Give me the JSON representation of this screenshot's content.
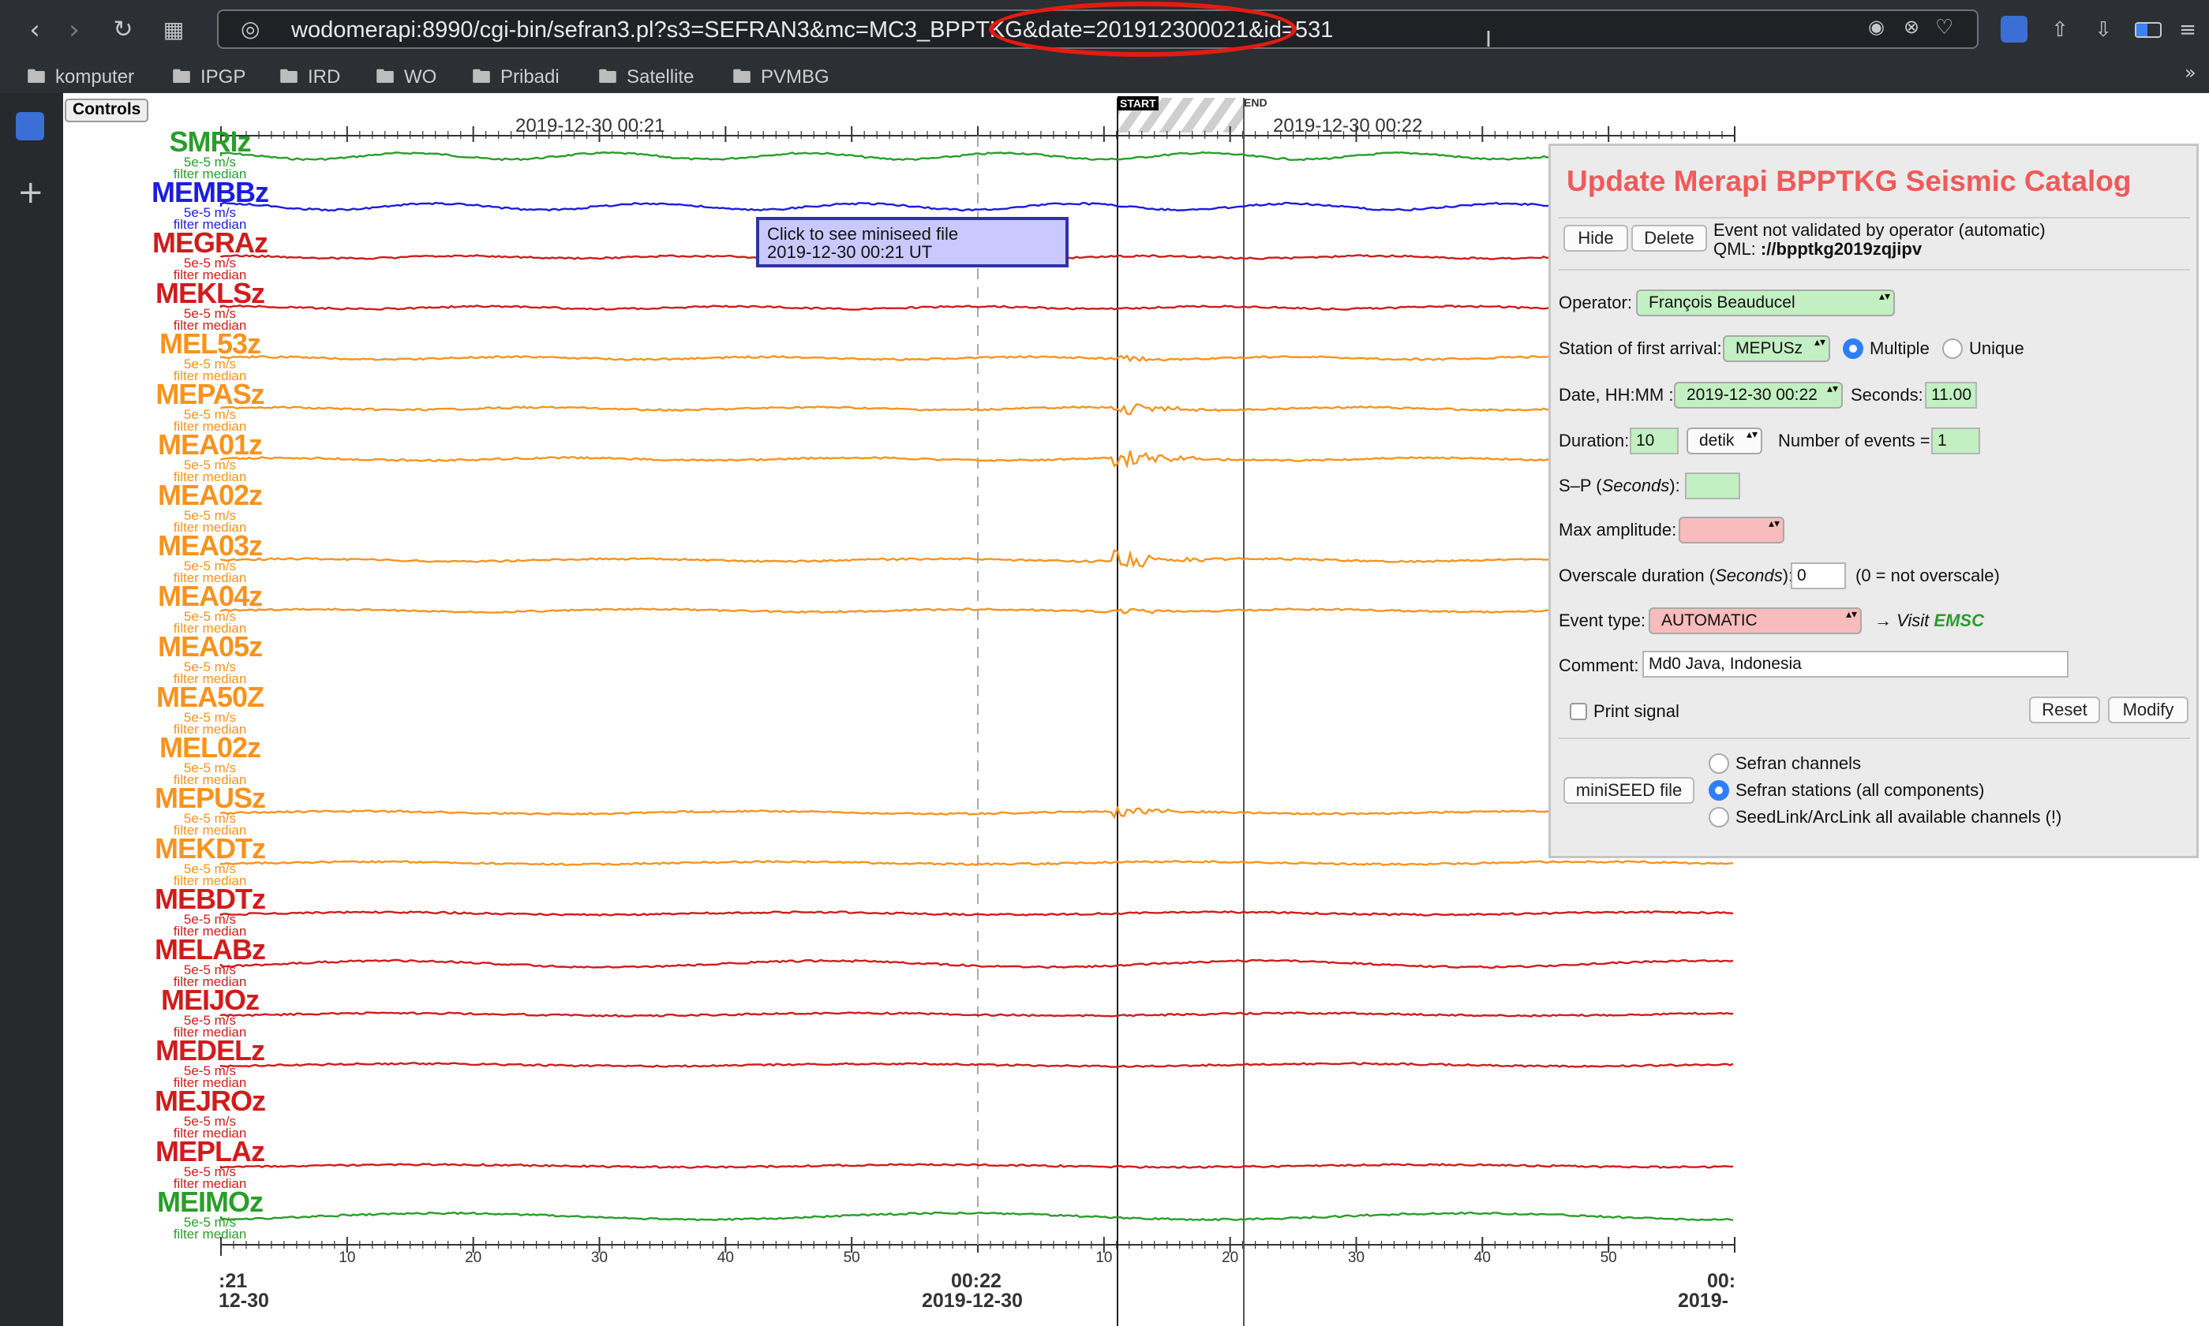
{
  "browser": {
    "url": "wodomerapi:8990/cgi-bin/sefran3.pl?s3=SEFRAN3&mc=MC3_BPPTKG&date=201912300021&id=531",
    "bookmarks": [
      "komputer",
      "IPGP",
      "IRD",
      "WO",
      "Pribadi",
      "Satellite",
      "PVMBG"
    ]
  },
  "controls_label": "Controls",
  "tooltip": {
    "line1": "Click to see miniseed file",
    "line2": "2019-12-30 00:21 UT"
  },
  "timeline": {
    "top_labels": [
      "2019-12-30 00:21",
      "2019-12-30 00:22"
    ],
    "start_label": "START",
    "end_label": "END",
    "bottom_ticks": [
      "10",
      "20",
      "30",
      "40",
      "50",
      "10",
      "20",
      "30",
      "40",
      "50"
    ],
    "bottom_left": ":21",
    "bottom_left_date": "12-30",
    "bottom_mid": "00:22",
    "bottom_mid_date": "2019-12-30",
    "bottom_right": "00:",
    "bottom_right_date": "2019-"
  },
  "channel_sub1": "5e-5 m/s",
  "channel_sub2": "filter median",
  "channels": [
    {
      "name": "SMRIz",
      "color": "#2a9d2a"
    },
    {
      "name": "MEMBBz",
      "color": "#1c1ce0"
    },
    {
      "name": "MEGRAz",
      "color": "#d01c1c"
    },
    {
      "name": "MEKLSz",
      "color": "#d01c1c"
    },
    {
      "name": "MEL53z",
      "color": "#f7931e"
    },
    {
      "name": "MEPASz",
      "color": "#f7931e"
    },
    {
      "name": "MEA01z",
      "color": "#f7931e"
    },
    {
      "name": "MEA02z",
      "color": "#f7931e"
    },
    {
      "name": "MEA03z",
      "color": "#f7931e"
    },
    {
      "name": "MEA04z",
      "color": "#f7931e"
    },
    {
      "name": "MEA05z",
      "color": "#f7931e"
    },
    {
      "name": "MEA50Z",
      "color": "#f7931e"
    },
    {
      "name": "MEL02z",
      "color": "#f7931e"
    },
    {
      "name": "MEPUSz",
      "color": "#f7931e"
    },
    {
      "name": "MEKDTz",
      "color": "#f7931e"
    },
    {
      "name": "MEBDTz",
      "color": "#d01c1c"
    },
    {
      "name": "MELABz",
      "color": "#d01c1c"
    },
    {
      "name": "MEIJOz",
      "color": "#d01c1c"
    },
    {
      "name": "MEDELz",
      "color": "#d01c1c"
    },
    {
      "name": "MEJROz",
      "color": "#d01c1c"
    },
    {
      "name": "MEPLAz",
      "color": "#d01c1c"
    },
    {
      "name": "MEIMOz",
      "color": "#2a9d2a"
    }
  ],
  "panel": {
    "title": "Update Merapi BPPTKG Seismic Catalog",
    "hide_label": "Hide",
    "delete_label": "Delete",
    "status_line1": "Event not validated by operator (automatic)",
    "status_line2_prefix": "QML: ",
    "status_line2_value": "://bpptkg2019zqjipv",
    "operator_label": "Operator:",
    "operator_value": "François Beauducel",
    "station_label": "Station of first arrival:",
    "station_value": "MEPUSz",
    "multiple_label": "Multiple",
    "unique_label": "Unique",
    "date_label": "Date, HH:MM :",
    "date_value": "2019-12-30 00:22",
    "seconds_label": "Seconds:",
    "seconds_value": "11.00",
    "duration_label": "Duration:",
    "duration_value": "10",
    "duration_unit": "detik",
    "num_events_label": "Number of events =",
    "num_events_value": "1",
    "sp_label_pre": "S–P (",
    "sp_label_em": "Seconds",
    "sp_label_post": "):",
    "max_amp_label": "Max amplitude:",
    "overscale_label_pre": "Overscale duration (",
    "overscale_label_em": "Seconds",
    "overscale_label_post": "):",
    "overscale_value": "0",
    "overscale_note": "(0 = not overscale)",
    "event_type_label": "Event type:",
    "event_type_value": "AUTOMATIC",
    "visit_prefix": "→ Visit ",
    "visit_link": "EMSC",
    "comment_label": "Comment:",
    "comment_value": "Md0 Java, Indonesia",
    "print_signal_label": "Print signal",
    "reset_label": "Reset",
    "modify_label": "Modify",
    "miniseed_label": "miniSEED file",
    "opt_channels": "Sefran channels",
    "opt_stations": "Sefran stations (all components)",
    "opt_seedlink": "SeedLink/ArcLink all available channels (!)"
  }
}
